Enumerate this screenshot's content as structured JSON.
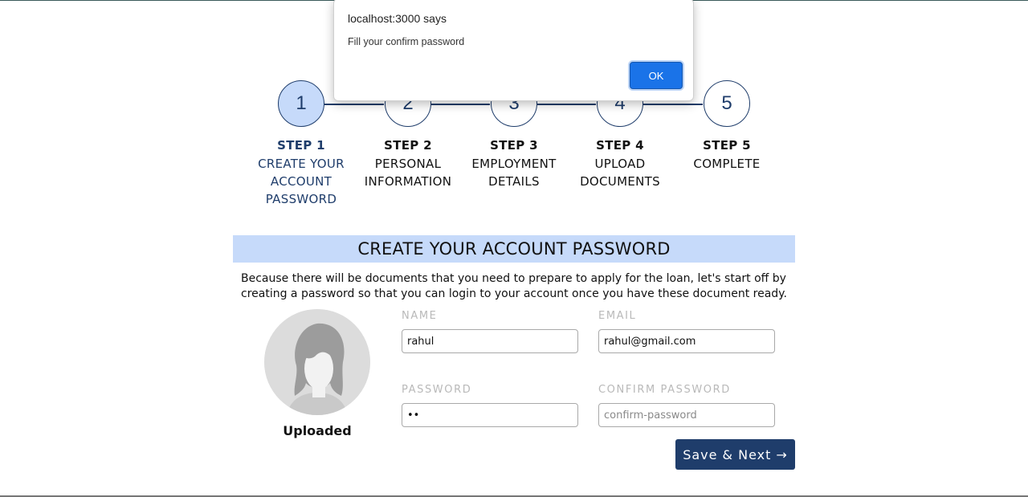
{
  "dialog": {
    "title": "localhost:3000 says",
    "message": "Fill your confirm password",
    "ok_label": "OK"
  },
  "steps": [
    {
      "number": "1",
      "title": "STEP 1",
      "desc": [
        "CREATE YOUR",
        "ACCOUNT",
        "PASSWORD"
      ],
      "active": true
    },
    {
      "number": "2",
      "title": "STEP 2",
      "desc": [
        "PERSONAL",
        "INFORMATION"
      ],
      "active": false
    },
    {
      "number": "3",
      "title": "STEP 3",
      "desc": [
        "EMPLOYMENT",
        "DETAILS"
      ],
      "active": false
    },
    {
      "number": "4",
      "title": "STEP 4",
      "desc": [
        "UPLOAD",
        "DOCUMENTS"
      ],
      "active": false
    },
    {
      "number": "5",
      "title": "STEP 5",
      "desc": [
        "COMPLETE"
      ],
      "active": false
    }
  ],
  "section": {
    "title": "CREATE YOUR ACCOUNT PASSWORD",
    "intro": "Because there will be documents that you need to prepare to apply for the loan, let's start off by creating a password so that you can login to your account once you have these document ready."
  },
  "avatar": {
    "status_label": "Uploaded"
  },
  "form": {
    "name": {
      "label": "NAME",
      "value": "rahul"
    },
    "email": {
      "label": "EMAIL",
      "value": "rahul@gmail.com"
    },
    "password": {
      "label": "PASSWORD",
      "value": "••"
    },
    "confirm_password": {
      "label": "CONFIRM PASSWORD",
      "value": "",
      "placeholder": "confirm-password"
    },
    "save_label": "Save & Next",
    "save_arrow": "→"
  },
  "colors": {
    "primary": "#1f3d6b",
    "highlight": "#c6dafa",
    "dialog_button": "#1a73e8"
  }
}
